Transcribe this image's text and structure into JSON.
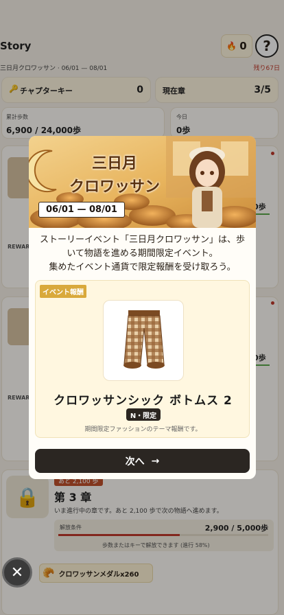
{
  "header": {
    "title": "Story",
    "event_subtitle": "三日月クロワッサン · 06/01 — 08/01",
    "remaining": "残り67日",
    "flame_count": "0",
    "help_label": "?"
  },
  "stats": {
    "chapter_key_label": "チャプターキー",
    "chapter_key_value": "0",
    "current_chapter_label": "現在章",
    "current_chapter_value": "3/5",
    "total_steps_label": "累計歩数",
    "total_steps_value": "6,900 / 24,000歩",
    "today_label": "今日",
    "today_value": "0歩"
  },
  "background_cards": {
    "reward_label_1": "REWAR",
    "reward_label_2": "REWAR",
    "step_fragment_1": "0歩",
    "step_fragment_2": "0歩"
  },
  "chapter3": {
    "badge": "あと 2,100 歩",
    "title": "第 3 章",
    "description": "いま進行中の章です。あと 2,100 歩で次の物語へ進めます。",
    "unlock_label": "解放条件",
    "unlock_value": "2,900 / 5,000歩",
    "unlock_progress": 0.58,
    "unlock_hint": "歩数またはキーで解放できます (進行 58%)",
    "reward_item": "クロワッサンメダルx260"
  },
  "modal": {
    "banner_title_line1": "三日月",
    "banner_title_line2": "クロワッサン",
    "date_range": "06/01 — 08/01",
    "description_line1": "ストーリーイベント「三日月クロワッサン」は、歩",
    "description_line2": "いて物語を進める期間限定イベント。",
    "description_line3": "集めたイベント通貨で限定報酬を受け取ろう。",
    "reward_tag": "イベント報酬",
    "item_name": "クロワッサンシック ボトムス 2",
    "rarity": "N・限定",
    "item_note": "期間限定ファッションのテーマ報酬です。",
    "next_label": "次へ",
    "next_arrow": "→"
  },
  "close_icon_label": "✕",
  "colors": {
    "accent": "#d9a93b",
    "dark": "#2b2622",
    "remain": "#c0392b",
    "progress": "#c0392b"
  }
}
